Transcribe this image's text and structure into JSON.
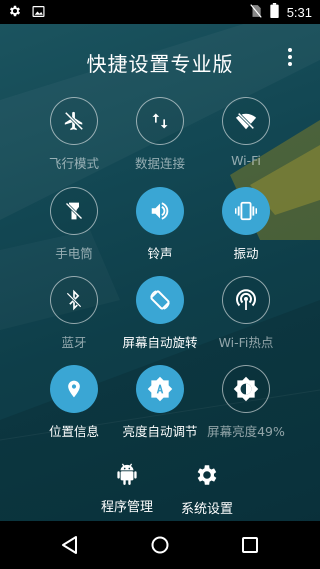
{
  "status_bar": {
    "time": "5:31",
    "left_icons": [
      "settings-gear-icon",
      "image-notification-icon"
    ],
    "right_icons": [
      "no-sim-icon",
      "battery-icon"
    ]
  },
  "header": {
    "title": "快捷设置专业版",
    "menu_icon": "more-vertical-icon"
  },
  "tiles": [
    {
      "label": "飞行模式",
      "icon": "airplane-off-icon",
      "active": false
    },
    {
      "label": "数据连接",
      "icon": "data-arrows-icon",
      "active": false
    },
    {
      "label": "Wi-Fi",
      "icon": "wifi-off-icon",
      "active": false
    },
    {
      "label": "手电筒",
      "icon": "flashlight-off-icon",
      "active": false
    },
    {
      "label": "铃声",
      "icon": "volume-up-icon",
      "active": true
    },
    {
      "label": "振动",
      "icon": "vibrate-icon",
      "active": true
    },
    {
      "label": "蓝牙",
      "icon": "bluetooth-off-icon",
      "active": false
    },
    {
      "label": "屏幕自动旋转",
      "icon": "screen-rotation-icon",
      "active": true
    },
    {
      "label": "Wi-Fi热点",
      "icon": "wifi-tethering-icon",
      "active": false
    },
    {
      "label": "位置信息",
      "icon": "location-icon",
      "active": true
    },
    {
      "label": "亮度自动调节",
      "icon": "brightness-auto-icon",
      "active": true
    },
    {
      "label": "屏幕亮度49%",
      "icon": "brightness-half-icon",
      "active": false
    }
  ],
  "shortcuts": [
    {
      "label": "程序管理",
      "icon": "android-icon"
    },
    {
      "label": "系统设置",
      "icon": "gear-icon"
    }
  ],
  "nav_bar": {
    "buttons": [
      "back-icon",
      "home-icon",
      "recents-icon"
    ]
  },
  "colors": {
    "accent": "#3aa6d4",
    "background": "#0d3a44",
    "status_bar": "#000000"
  }
}
